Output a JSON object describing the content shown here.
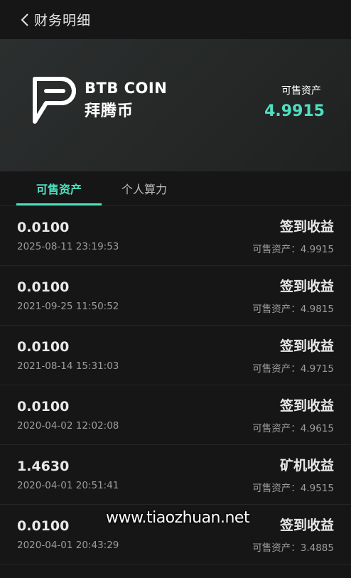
{
  "header": {
    "title": "财务明细"
  },
  "banner": {
    "brand_en": "BTB COIN",
    "brand_cn": "拜腾币",
    "asset_label": "可售资产",
    "asset_value": "4.9915",
    "accent_color": "#4ee0c0"
  },
  "tabs": [
    {
      "label": "可售资产",
      "active": true
    },
    {
      "label": "个人算力",
      "active": false
    }
  ],
  "records": [
    {
      "amount": "0.0100",
      "time": "2025-08-11 23:19:53",
      "type": "签到收益",
      "balance": "可售资产：4.9915"
    },
    {
      "amount": "0.0100",
      "time": "2021-09-25 11:50:52",
      "type": "签到收益",
      "balance": "可售资产：4.9815"
    },
    {
      "amount": "0.0100",
      "time": "2021-08-14 15:31:03",
      "type": "签到收益",
      "balance": "可售资产：4.9715"
    },
    {
      "amount": "0.0100",
      "time": "2020-04-02 12:02:08",
      "type": "签到收益",
      "balance": "可售资产：4.9615"
    },
    {
      "amount": "1.4630",
      "time": "2020-04-01 20:51:41",
      "type": "矿机收益",
      "balance": "可售资产：4.9515"
    },
    {
      "amount": "0.0100",
      "time": "2020-04-01 20:43:29",
      "type": "签到收益",
      "balance": "可售资产：3.4885"
    }
  ],
  "watermark": "www.tiaozhuan.net"
}
